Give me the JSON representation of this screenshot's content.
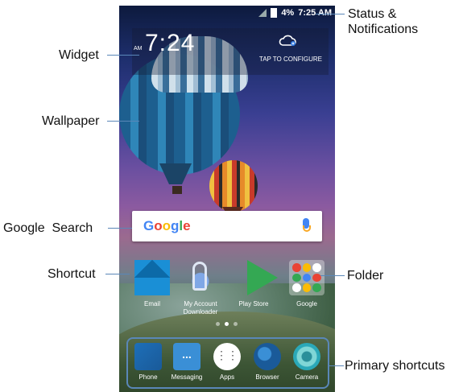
{
  "callouts": {
    "status": "Status &\nNotifications",
    "widget": "Widget",
    "wallpaper": "Wallpaper",
    "google_search": "Google  Search",
    "shortcut": "Shortcut",
    "folder": "Folder",
    "primary_shortcuts": "Primary shortcuts"
  },
  "status_bar": {
    "battery": "4%",
    "time": "7:25 AM"
  },
  "widget": {
    "ampm": "AM",
    "clock": "7:24",
    "configure": "TAP TO CONFIGURE"
  },
  "search": {
    "logo": "Google"
  },
  "apps": [
    {
      "label": "Email"
    },
    {
      "label": "My Account Downloader"
    },
    {
      "label": "Play Store"
    },
    {
      "label": "Google"
    }
  ],
  "dock": [
    {
      "label": "Phone"
    },
    {
      "label": "Messaging"
    },
    {
      "label": "Apps"
    },
    {
      "label": "Browser"
    },
    {
      "label": "Camera"
    }
  ],
  "colors": {
    "leader_line": "#5a87b8",
    "google_blue": "#4285f4",
    "google_red": "#ea4335",
    "google_yellow": "#fbbc05",
    "google_green": "#34a853"
  }
}
